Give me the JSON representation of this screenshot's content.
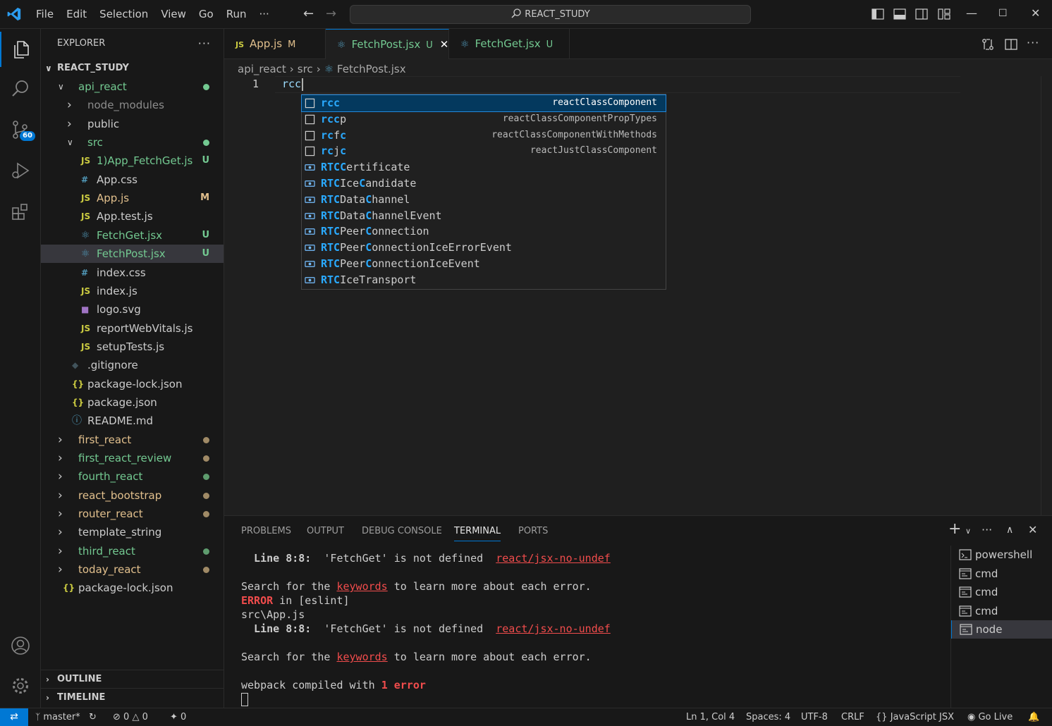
{
  "titlebar": {
    "menu": [
      "File",
      "Edit",
      "Selection",
      "View",
      "Go",
      "Run",
      "···"
    ],
    "search_text": "REACT_STUDY"
  },
  "activity": {
    "scm_badge": "60"
  },
  "explorer": {
    "title": "EXPLORER",
    "more": "···",
    "root": "REACT_STUDY",
    "items": [
      {
        "label": "api_react",
        "indent": 1,
        "kind": "folder-open",
        "color": "#73c991",
        "status": "dot",
        "status_color": "#73c991"
      },
      {
        "label": "node_modules",
        "indent": 2,
        "kind": "folder",
        "color": "#8c8c8c"
      },
      {
        "label": "public",
        "indent": 2,
        "kind": "folder",
        "color": "#cccccc"
      },
      {
        "label": "src",
        "indent": 2,
        "kind": "folder-open",
        "color": "#73c991",
        "status": "dot",
        "status_color": "#73c991"
      },
      {
        "label": "1)App_FetchGet.js",
        "indent": 3,
        "kind": "js",
        "color": "#73c991",
        "status": "U",
        "status_color": "#73c991"
      },
      {
        "label": "App.css",
        "indent": 3,
        "kind": "css",
        "color": "#cccccc"
      },
      {
        "label": "App.js",
        "indent": 3,
        "kind": "js",
        "color": "#e2c08d",
        "status": "M",
        "status_color": "#e2c08d"
      },
      {
        "label": "App.test.js",
        "indent": 3,
        "kind": "js",
        "color": "#cccccc"
      },
      {
        "label": "FetchGet.jsx",
        "indent": 3,
        "kind": "react",
        "color": "#73c991",
        "status": "U",
        "status_color": "#73c991"
      },
      {
        "label": "FetchPost.jsx",
        "indent": 3,
        "kind": "react",
        "color": "#73c991",
        "status": "U",
        "status_color": "#73c991",
        "selected": true
      },
      {
        "label": "index.css",
        "indent": 3,
        "kind": "css",
        "color": "#cccccc"
      },
      {
        "label": "index.js",
        "indent": 3,
        "kind": "js",
        "color": "#cccccc"
      },
      {
        "label": "logo.svg",
        "indent": 3,
        "kind": "svg",
        "color": "#cccccc"
      },
      {
        "label": "reportWebVitals.js",
        "indent": 3,
        "kind": "js",
        "color": "#cccccc"
      },
      {
        "label": "setupTests.js",
        "indent": 3,
        "kind": "js",
        "color": "#cccccc"
      },
      {
        "label": ".gitignore",
        "indent": 2,
        "kind": "git",
        "color": "#cccccc"
      },
      {
        "label": "package-lock.json",
        "indent": 2,
        "kind": "json",
        "color": "#cccccc"
      },
      {
        "label": "package.json",
        "indent": 2,
        "kind": "json",
        "color": "#cccccc"
      },
      {
        "label": "README.md",
        "indent": 2,
        "kind": "info",
        "color": "#cccccc"
      },
      {
        "label": "first_react",
        "indent": 1,
        "kind": "folder",
        "color": "#e2c08d",
        "status": "dot",
        "status_color": "#a08a66"
      },
      {
        "label": "first_react_review",
        "indent": 1,
        "kind": "folder",
        "color": "#73c991",
        "status": "dot",
        "status_color": "#a08a66"
      },
      {
        "label": "fourth_react",
        "indent": 1,
        "kind": "folder",
        "color": "#73c991",
        "status": "dot",
        "status_color": "#5e9c6e"
      },
      {
        "label": "react_bootstrap",
        "indent": 1,
        "kind": "folder",
        "color": "#e2c08d",
        "status": "dot",
        "status_color": "#a08a66"
      },
      {
        "label": "router_react",
        "indent": 1,
        "kind": "folder",
        "color": "#e2c08d",
        "status": "dot",
        "status_color": "#a08a66"
      },
      {
        "label": "template_string",
        "indent": 1,
        "kind": "folder",
        "color": "#cccccc"
      },
      {
        "label": "third_react",
        "indent": 1,
        "kind": "folder",
        "color": "#73c991",
        "status": "dot",
        "status_color": "#5e9c6e"
      },
      {
        "label": "today_react",
        "indent": 1,
        "kind": "folder",
        "color": "#e2c08d",
        "status": "dot",
        "status_color": "#a08a66"
      },
      {
        "label": "package-lock.json",
        "indent": 1,
        "kind": "json",
        "color": "#cccccc"
      }
    ],
    "outline": "OUTLINE",
    "timeline": "TIMELINE"
  },
  "tabs": [
    {
      "icon": "JS",
      "label": "App.js",
      "status": "M",
      "color": "#e2c08d",
      "active": false
    },
    {
      "icon": "react",
      "label": "FetchPost.jsx",
      "status": "U",
      "color": "#73c991",
      "active": true,
      "close": "✕"
    },
    {
      "icon": "react",
      "label": "FetchGet.jsx",
      "status": "U",
      "color": "#73c991",
      "active": false
    }
  ],
  "breadcrumb": {
    "parts": [
      "api_react",
      "src",
      "FetchPost.jsx"
    ],
    "sep": "›"
  },
  "editor": {
    "line_number": "1",
    "code": "rcc"
  },
  "suggest": [
    {
      "match": "rcc",
      "rest": "",
      "detail": "reactClassComponent",
      "kind": "snippet",
      "focused": true
    },
    {
      "match": "rcc",
      "rest": "p",
      "detail": "reactClassComponentPropTypes",
      "kind": "snippet"
    },
    {
      "match": "rc",
      "rest": "fc",
      "detail": "reactClassComponentWithMethods",
      "kind": "snippet",
      "mixed": [
        "r",
        "c",
        "f",
        "c"
      ]
    },
    {
      "match": "rc",
      "rest": "jc",
      "detail": "reactJustClassComponent",
      "kind": "snippet",
      "mixed": [
        "r",
        "c",
        "j",
        "c"
      ]
    },
    {
      "label": "RTCCertificate",
      "hl": [
        "R",
        "T",
        "C",
        "C"
      ],
      "kind": "var"
    },
    {
      "label": "RTCIceCandidate",
      "kind": "var"
    },
    {
      "label": "RTCDataChannel",
      "kind": "var"
    },
    {
      "label": "RTCDataChannelEvent",
      "kind": "var"
    },
    {
      "label": "RTCPeerConnection",
      "kind": "var"
    },
    {
      "label": "RTCPeerConnectionIceErrorEvent",
      "kind": "var"
    },
    {
      "label": "RTCPeerConnectionIceEvent",
      "kind": "var"
    },
    {
      "label": "RTCIceTransport",
      "kind": "var"
    }
  ],
  "panel": {
    "tabs": [
      "PROBLEMS",
      "OUTPUT",
      "DEBUG CONSOLE",
      "TERMINAL",
      "PORTS"
    ],
    "active_tab": "TERMINAL",
    "terminal": {
      "l1_a": "  Line 8:8:",
      "l1_b": "  'FetchGet' is not defined  ",
      "l1_link": "react/jsx-no-undef",
      "l3_a": "Search for the ",
      "l3_link": "keywords",
      "l3_b": " to learn more about each error.",
      "l4_err": "ERROR",
      "l4_rest": " in [eslint]",
      "l5": "src\\App.js",
      "l6_a": "  Line 8:8:",
      "l6_b": "  'FetchGet' is not defined  ",
      "l6_link": "react/jsx-no-undef",
      "l8_a": "Search for the ",
      "l8_link": "keywords",
      "l8_b": " to learn more about each error.",
      "l10_a": "webpack compiled with ",
      "l10_err": "1 error"
    },
    "terminals": [
      {
        "label": "powershell"
      },
      {
        "label": "cmd"
      },
      {
        "label": "cmd"
      },
      {
        "label": "cmd"
      },
      {
        "label": "node",
        "active": true
      }
    ]
  },
  "status": {
    "branch": "master*",
    "errors": "0",
    "warnings": "0",
    "ports": "0",
    "position": "Ln 1, Col 4",
    "spaces": "Spaces: 4",
    "encoding": "UTF-8",
    "eol": "CRLF",
    "language": "JavaScript JSX",
    "golive": "Go Live",
    "lang_braces": "{}"
  }
}
